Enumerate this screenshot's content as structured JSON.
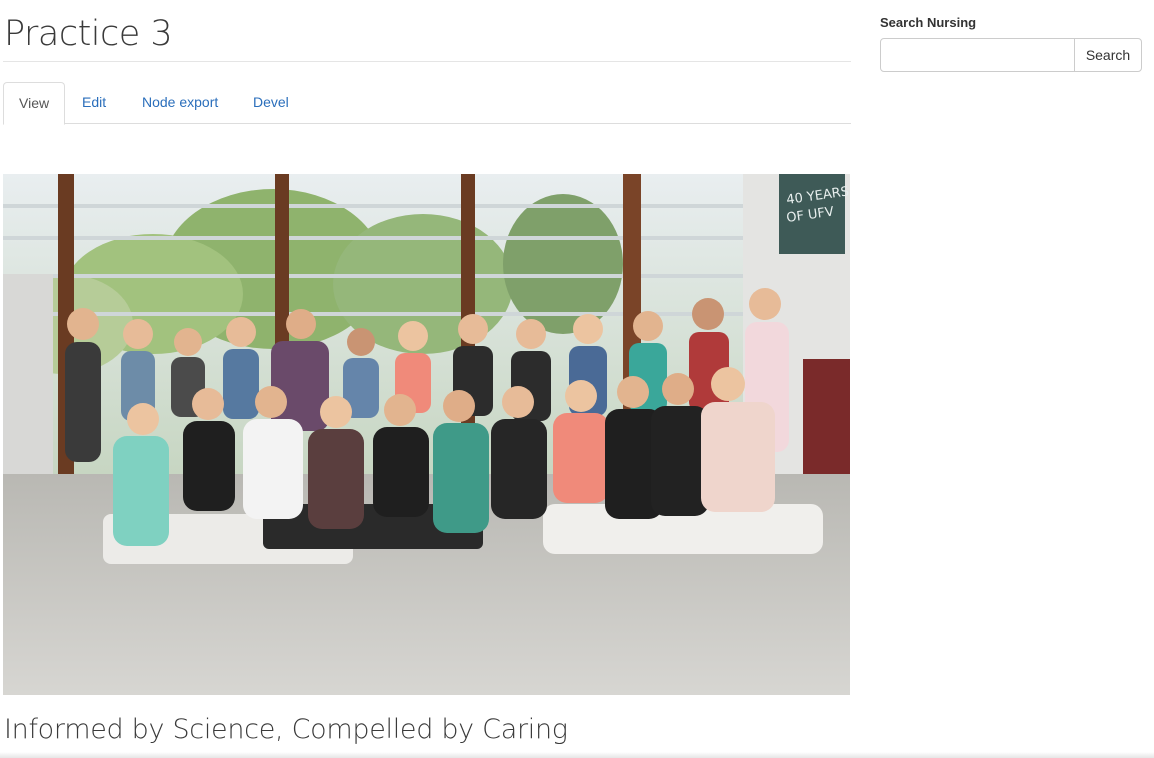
{
  "page": {
    "title": "Practice 3",
    "tagline": "Informed by Science, Compelled by Caring"
  },
  "tabs": [
    {
      "label": "View",
      "active": true
    },
    {
      "label": "Edit",
      "active": false
    },
    {
      "label": "Node export",
      "active": false
    },
    {
      "label": "Devel",
      "active": false
    }
  ],
  "photo": {
    "sign_text": [
      "40 YEARS",
      "OF UFV"
    ]
  },
  "sidebar": {
    "search_label": "Search Nursing",
    "search_placeholder": "",
    "search_button": "Search"
  },
  "colors": {
    "link": "#2a6ebb",
    "border": "#dddddd"
  }
}
